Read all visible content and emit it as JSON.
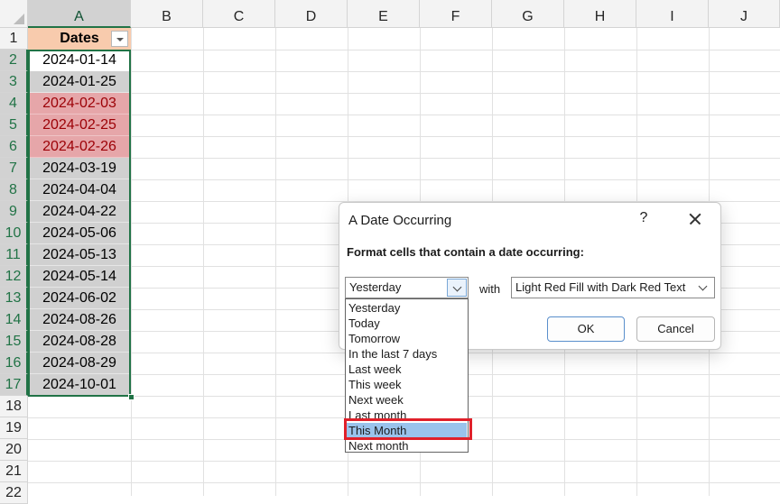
{
  "columns": [
    "A",
    "B",
    "C",
    "D",
    "E",
    "F",
    "G",
    "H",
    "I",
    "J"
  ],
  "rows": [
    "1",
    "2",
    "3",
    "4",
    "5",
    "6",
    "7",
    "8",
    "9",
    "10",
    "11",
    "12",
    "13",
    "14",
    "15",
    "16",
    "17",
    "18",
    "19",
    "20",
    "21",
    "22"
  ],
  "sheet": {
    "header": "Dates",
    "dates": [
      "2024-01-14",
      "2024-01-25",
      "2024-02-03",
      "2024-02-25",
      "2024-02-26",
      "2024-03-19",
      "2024-04-04",
      "2024-04-22",
      "2024-05-06",
      "2024-05-13",
      "2024-05-14",
      "2024-06-02",
      "2024-08-26",
      "2024-08-28",
      "2024-08-29",
      "2024-10-01"
    ],
    "highlighted_rows": [
      4,
      5,
      6
    ]
  },
  "dialog": {
    "title": "A Date Occurring",
    "help": "?",
    "label": "Format cells that contain a date occurring:",
    "condition_value": "Yesterday",
    "with_label": "with",
    "format_value": "Light Red Fill with Dark Red Text",
    "ok_label": "OK",
    "cancel_label": "Cancel",
    "options": [
      "Yesterday",
      "Today",
      "Tomorrow",
      "In the last 7 days",
      "Last week",
      "This week",
      "Next week",
      "Last month",
      "This Month",
      "Next month"
    ],
    "highlighted_option": "This Month"
  },
  "colors": {
    "selection": "#217346",
    "header_fill": "#f8cbad",
    "highlight_fill": "#e6a6a9",
    "highlight_text": "#9c0006",
    "callout": "#e0202a"
  },
  "icons": {
    "filter": "filter-dropdown-icon",
    "close": "close-icon",
    "help": "help-icon",
    "dropdown": "chevron-down-icon"
  }
}
